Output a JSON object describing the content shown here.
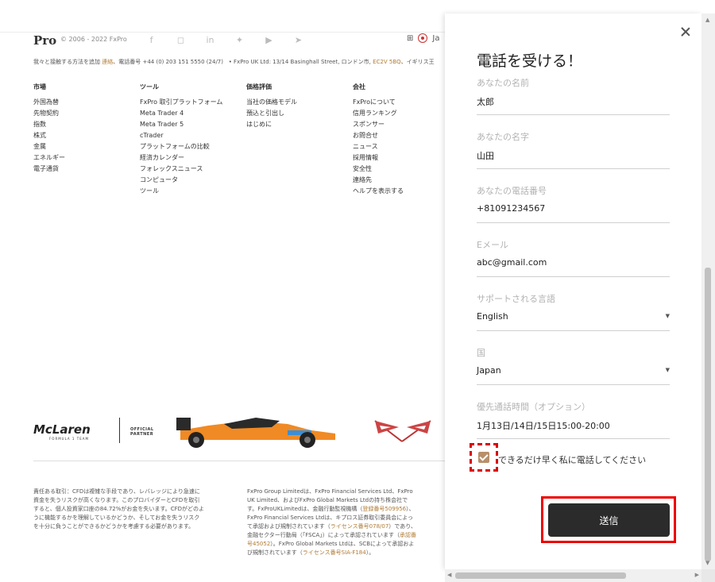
{
  "footer": {
    "brand": "Pro",
    "copyright": "© 2006 - 2022 FxPro",
    "social_icons": [
      "facebook-icon",
      "instagram-icon",
      "linkedin-icon",
      "twitter-icon",
      "youtube-icon",
      "telegram-icon"
    ],
    "language": "Ja",
    "contact_prefix": "我々と接触する方法を追加",
    "contact_link": "連絡",
    "contact_phone": "、電話番号 +44 (0) 203 151 5550 (24/7)",
    "contact_address": "• FxPro UK Ltd: 13/14 Basinghall Street, ロンドン市,",
    "contact_postcode": "EC2V 5BQ",
    "contact_tail": "、イギリス王",
    "columns": [
      {
        "title": "市場",
        "items": [
          "外国為替",
          "先物契約",
          "指数",
          "株式",
          "金属",
          "エネルギー",
          "電子通貨"
        ]
      },
      {
        "title": "ツール",
        "items": [
          "FxPro 取引プラットフォーム",
          "Meta Trader 4",
          "Meta Trader 5",
          "cTrader",
          "プラットフォームの比較",
          "経済カレンダー",
          "フォレックスニュース",
          "コンピュータ",
          "ツール"
        ]
      },
      {
        "title": "価格評価",
        "items": [
          "当社の価格モデル",
          "預込と引出し",
          "はじめに"
        ]
      },
      {
        "title": "会社",
        "items": [
          "FxProについて",
          "信用ランキング",
          "スポンサー",
          "お問合せ",
          "ニュース",
          "採用情報",
          "安全性",
          "連絡先",
          "ヘルプを表示する"
        ]
      }
    ],
    "sponsor_brand": "McLaren",
    "sponsor_sub": "FORMULA 1 TEAM",
    "sponsor_official_1": "OFFICIAL",
    "sponsor_official_2": "PARTNER",
    "disclaimer_left": "責任ある取引：CFDは複雑な手段であり、レバレッジにより急速に資金を失うリスクが高くなります。このプロバイダーとCFDを取引すると、個人投資家口座の84.72%がお金を失います。CFDがどのように機能するかを理解しているかどうか、そしてお金を失うリスクを十分に負うことができるかどうかを考慮する必要があります。",
    "disclaimer_right_1": "FxPro Group Limitedは、FxPro Financial Services Ltd、FxPro UK Limited、およびFxPro Global Markets Ltdの持ち株会社です。FxProUKLimitedは、金融行動監視機構（",
    "disclaimer_right_link1": "登録番号509956",
    "disclaimer_right_2": "）、FxPro Financial Services Ltdは、キプロス証券取引委員会によって承認および規制されています（",
    "disclaimer_right_link2": "ライセンス番号078/07",
    "disclaimer_right_3": "）であり、金融セクター行動局（「FSCA」）によって承認されています（",
    "disclaimer_right_link3": "承認番号45052",
    "disclaimer_right_4": "）。FxPro Global Markets Ltdは、SCBによって承認および規制されています（",
    "disclaimer_right_link4": "ライセンス番号SIA-F184",
    "disclaimer_right_5": "）。"
  },
  "modal": {
    "title": "電話を受ける！",
    "fields": [
      {
        "label": "あなたの名前",
        "value": "太郎"
      },
      {
        "label": "あなたの名字",
        "value": "山田"
      },
      {
        "label": "あなたの電話番号",
        "value": "+81091234567"
      },
      {
        "label": "Eメール",
        "value": "abc@gmail.com"
      },
      {
        "label": "サポートされる言語",
        "value": "English"
      },
      {
        "label": "国",
        "value": "Japan"
      },
      {
        "label": "優先通話時間（オプション）",
        "value": "1月13日/14日/15日15:00-20:00"
      }
    ],
    "checkbox_label": "できるだけ早く私に電話してください",
    "checkbox_checked": true,
    "submit_label": "送信"
  }
}
